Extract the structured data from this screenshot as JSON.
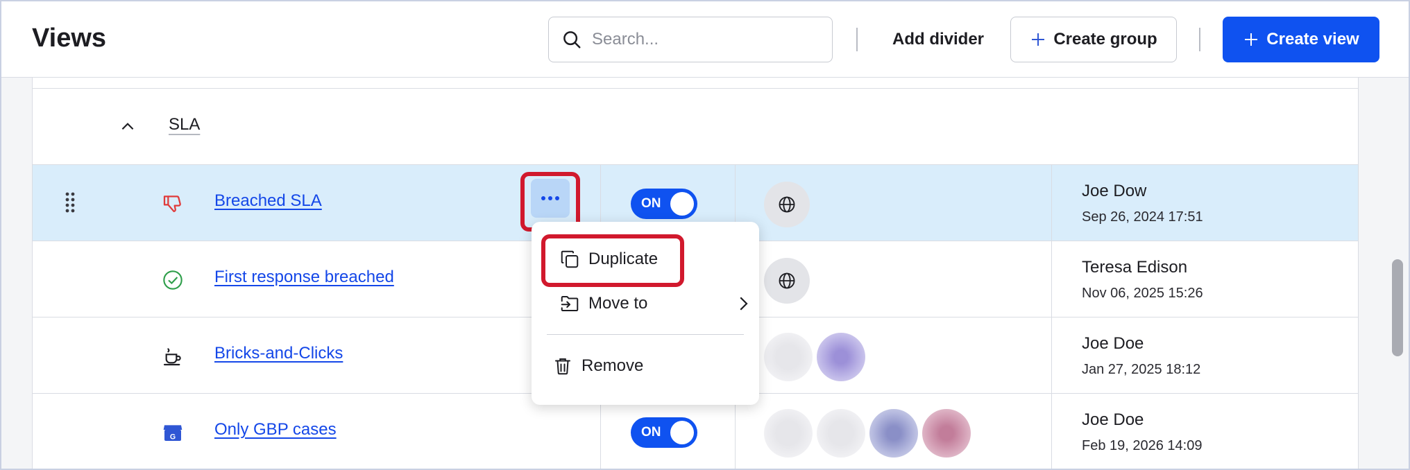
{
  "header": {
    "title": "Views",
    "search_placeholder": "Search...",
    "add_divider_label": "Add divider",
    "create_group_label": "Create group",
    "create_view_label": "Create view"
  },
  "group": {
    "name": "SLA",
    "expanded": true
  },
  "rows": [
    {
      "name": "Breached SLA",
      "icon": "thumbs-down-icon",
      "icon_color": "#e03b3b",
      "toggle": "ON",
      "visibility": "globe-icon",
      "person": "Joe Dow",
      "date": "Sep 26, 2024 17:51",
      "selected": true
    },
    {
      "name": "First response breached",
      "icon": "check-circle-icon",
      "icon_color": "#2e9e4a",
      "toggle": null,
      "visibility": "globe-icon",
      "person": "Teresa Edison",
      "date": "Nov 06, 2025 15:26",
      "selected": false
    },
    {
      "name": "Bricks-and-Clicks",
      "icon": "coffee-cup-icon",
      "icon_color": "#1d1d22",
      "toggle": null,
      "visibility": "avatars",
      "person": "Joe Doe",
      "date": "Jan 27, 2025 18:12",
      "selected": false
    },
    {
      "name": "Only GBP cases",
      "icon": "store-icon",
      "icon_color": "#2f56d4",
      "toggle": "ON",
      "visibility": "avatars",
      "person": "Joe Doe",
      "date": "Feb 19, 2026 14:09",
      "selected": false
    }
  ],
  "context_menu": {
    "duplicate": "Duplicate",
    "move_to": "Move to",
    "remove": "Remove"
  },
  "colors": {
    "primary": "#0f52f0",
    "selected_row": "#d9edfb",
    "highlight": "#d1192d",
    "link": "#1447e8"
  }
}
